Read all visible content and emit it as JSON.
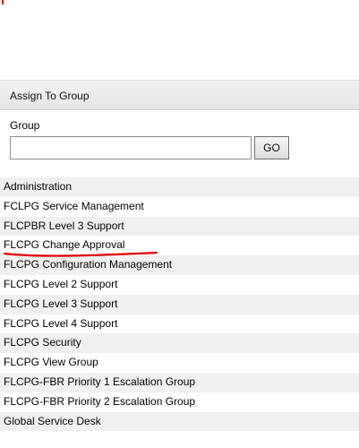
{
  "assign_panel": {
    "title": "Assign To Group",
    "group_label": "Group",
    "search_value": "",
    "go_label": "GO"
  },
  "groups": [
    {
      "label": "Administration"
    },
    {
      "label": "FCLPG Service Management"
    },
    {
      "label": "FLCPBR Level 3 Support"
    },
    {
      "label": "FLCPG Change Approval"
    },
    {
      "label": "FLCPG Configuration Management"
    },
    {
      "label": "FLCPG Level 2 Support"
    },
    {
      "label": "FLCPG Level 3 Support"
    },
    {
      "label": "FLCPG Level 4 Support"
    },
    {
      "label": "FLCPG Security"
    },
    {
      "label": "FLCPG View Group"
    },
    {
      "label": "FLCPG-FBR Priority 1 Escalation Group"
    },
    {
      "label": "FLCPG-FBR Priority 2 Escalation Group"
    },
    {
      "label": "Global Service Desk"
    }
  ],
  "colors": {
    "annotation": "#e00000",
    "row_alt": "#f0f0f0",
    "header_bg": "#ececec"
  }
}
